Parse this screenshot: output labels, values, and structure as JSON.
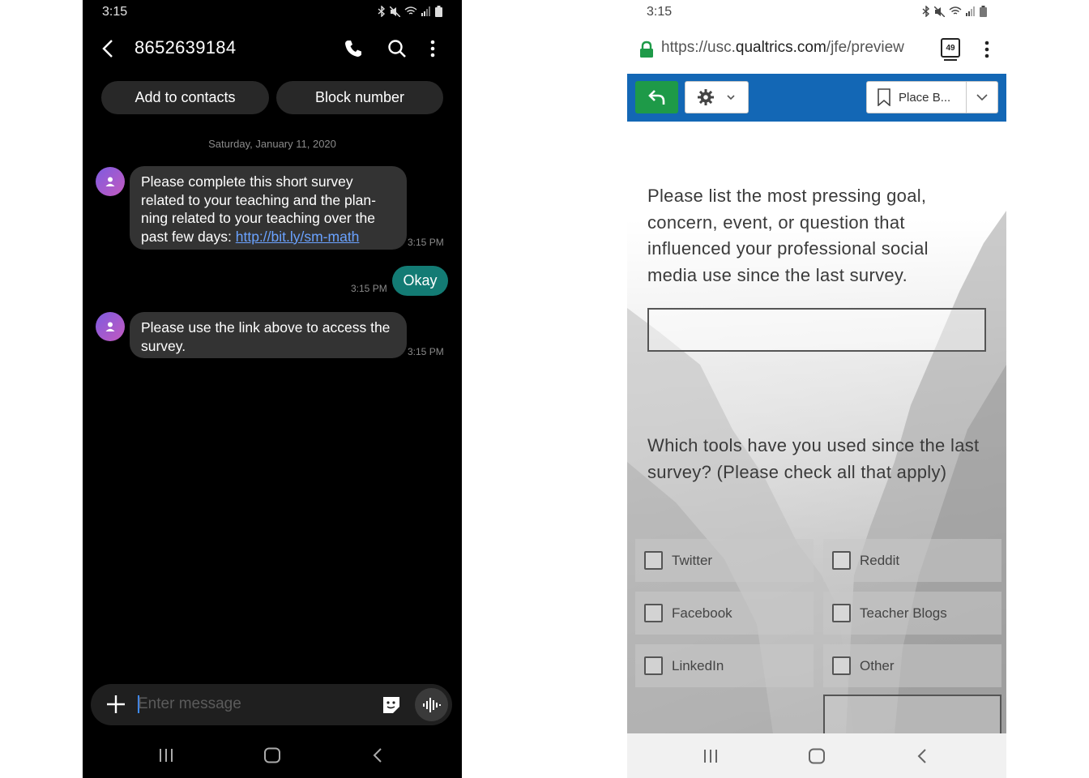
{
  "left_phone": {
    "status_time": "3:15",
    "contact_number": "8652639184",
    "actions": {
      "add_contacts": "Add to contacts",
      "block_number": "Block number"
    },
    "date_separator": "Saturday, January 11, 2020",
    "messages": [
      {
        "direction": "incoming",
        "text_before_link": "Please complete this short survey related to your teaching and the plan-ning related to your teaching over the past few days: ",
        "link": "http://bit.ly/sm-math",
        "time": "3:15 PM"
      },
      {
        "direction": "outgoing",
        "text": "Okay",
        "time": "3:15 PM"
      },
      {
        "direction": "incoming",
        "text": "Please use the link above to access the survey.",
        "time": "3:15 PM"
      }
    ],
    "composer": {
      "placeholder": "Enter message"
    },
    "colors": {
      "background": "#000000",
      "incoming_bubble": "#333333",
      "outgoing_bubble": "#137b74",
      "link": "#6aa2ff"
    }
  },
  "right_phone": {
    "status_time": "3:15",
    "url_prefix": "https://usc.",
    "url_domain": "qualtrics.com",
    "url_path": "/jfe/preview",
    "tab_count": "49",
    "toolbar": {
      "bookmark_label": "Place B..."
    },
    "questions": [
      {
        "text": "Please list the most pressing goal, concern, event, or question that influenced your professional social media use since the last survey."
      },
      {
        "text": "Which tools have you used since the last survey? (Please check all that apply)",
        "options": [
          "Twitter",
          "Reddit",
          "Facebook",
          "Teacher Blogs",
          "LinkedIn",
          "Other"
        ]
      }
    ],
    "colors": {
      "toolbar": "#1367b5",
      "undo_button": "#1e9a48",
      "lock": "#1e9a48"
    }
  }
}
